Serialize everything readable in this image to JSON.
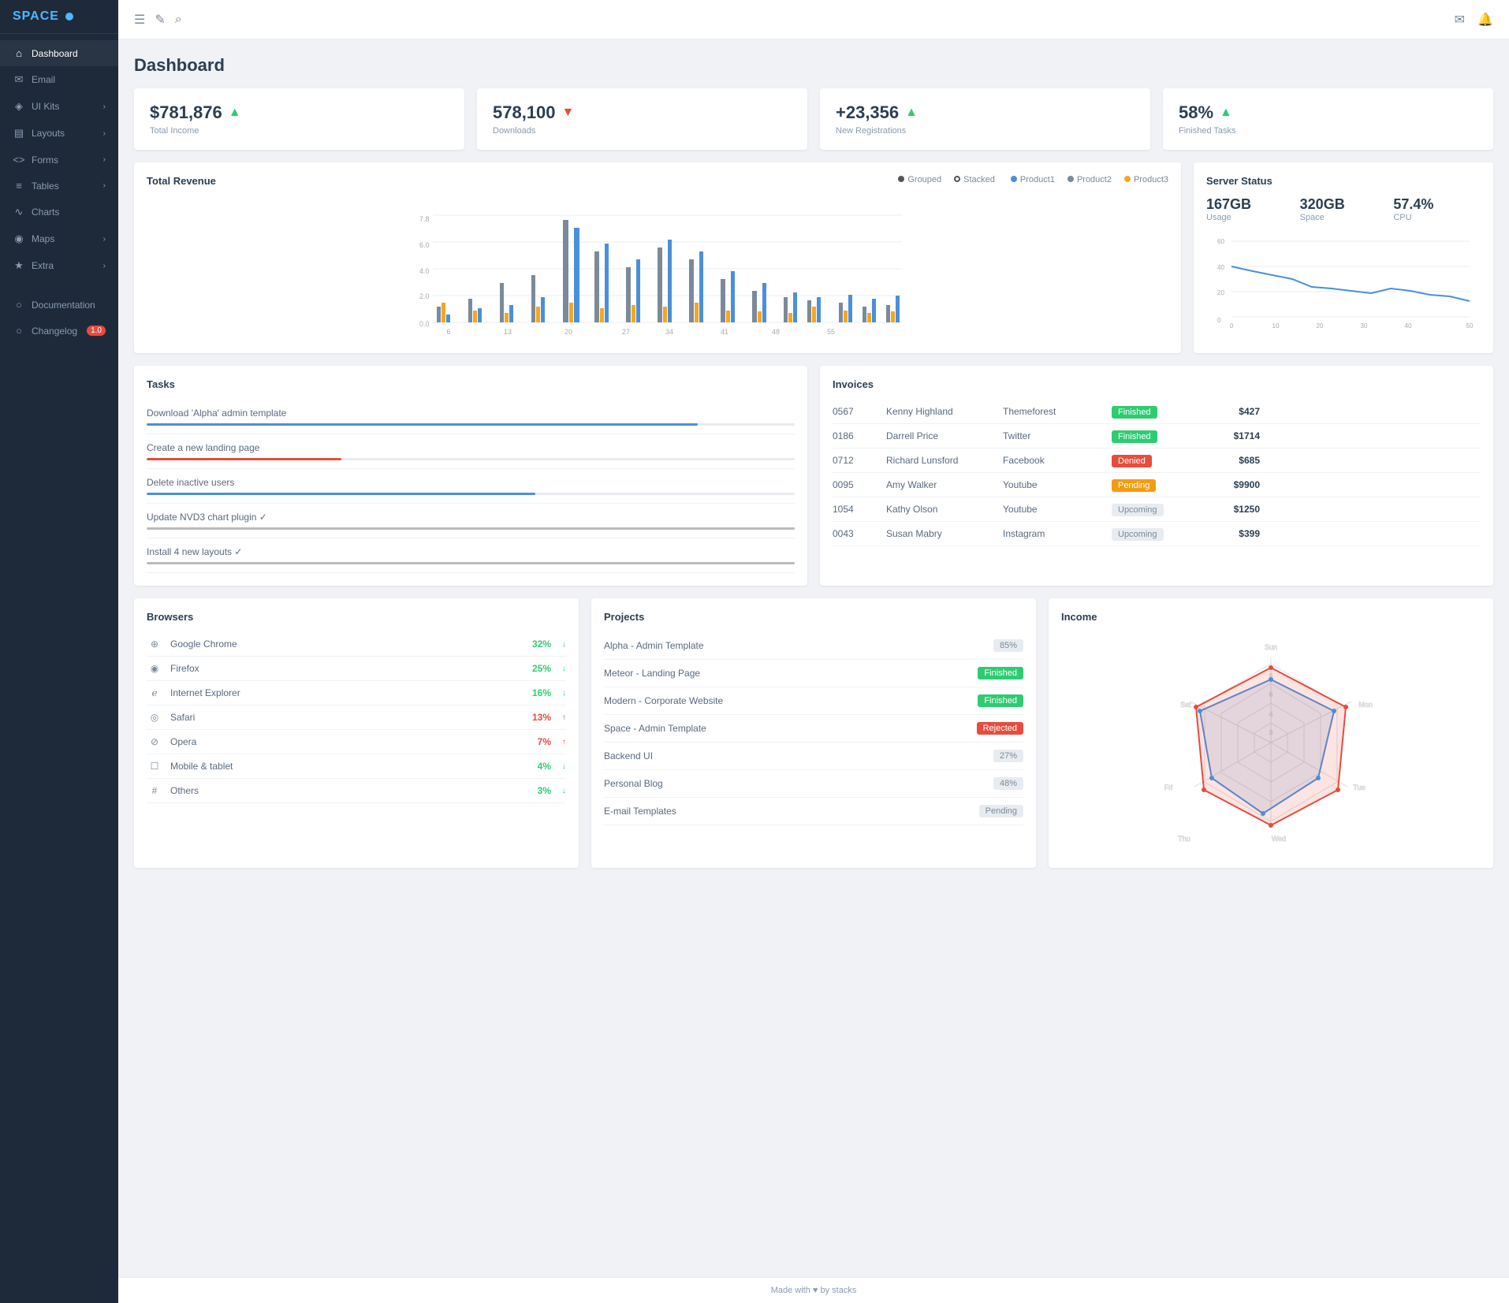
{
  "sidebar": {
    "logo": "SPACE",
    "items": [
      {
        "label": "Dashboard",
        "icon": "⌂",
        "active": true,
        "hasChevron": false
      },
      {
        "label": "Email",
        "icon": "✉",
        "active": false,
        "hasChevron": false
      },
      {
        "label": "UI Kits",
        "icon": "◈",
        "active": false,
        "hasChevron": true
      },
      {
        "label": "Layouts",
        "icon": "▤",
        "active": false,
        "hasChevron": true
      },
      {
        "label": "Forms",
        "icon": "<>",
        "active": false,
        "hasChevron": true
      },
      {
        "label": "Tables",
        "icon": "≡",
        "active": false,
        "hasChevron": true
      },
      {
        "label": "Charts",
        "icon": "∿",
        "active": false,
        "hasChevron": false
      },
      {
        "label": "Maps",
        "icon": "◉",
        "active": false,
        "hasChevron": true
      },
      {
        "label": "Extra",
        "icon": "★",
        "active": false,
        "hasChevron": true
      },
      {
        "label": "Documentation",
        "icon": "○",
        "active": false,
        "hasChevron": false
      },
      {
        "label": "Changelog",
        "icon": "○",
        "active": false,
        "hasChevron": false,
        "badge": "1.0"
      }
    ]
  },
  "header": {
    "title": "Dashboard",
    "topbar_icons": [
      "≡",
      "✎",
      "⌕"
    ]
  },
  "stats": [
    {
      "value": "$781,876",
      "label": "Total Income",
      "trend": "up"
    },
    {
      "value": "578,100",
      "label": "Downloads",
      "trend": "down"
    },
    {
      "value": "+23,356",
      "label": "New Registrations",
      "trend": "up"
    },
    {
      "value": "58%",
      "label": "Finished Tasks",
      "trend": "up"
    }
  ],
  "total_revenue": {
    "title": "Total Revenue",
    "legend": [
      {
        "label": "Grouped",
        "type": "dot",
        "color": "#555"
      },
      {
        "label": "Stacked",
        "type": "circle",
        "color": "#555"
      }
    ],
    "products": [
      {
        "label": "Product1",
        "color": "#4a90d9"
      },
      {
        "label": "Product2",
        "color": "#7a8a9a"
      },
      {
        "label": "Product3",
        "color": "#f5a623"
      }
    ],
    "x_labels": [
      "6",
      "13",
      "20",
      "27",
      "34",
      "41",
      "48",
      "55"
    ]
  },
  "server_status": {
    "title": "Server Status",
    "stats": [
      {
        "value": "167GB",
        "label": "Usage"
      },
      {
        "value": "320GB",
        "label": "Space"
      },
      {
        "value": "57.4%",
        "label": "CPU"
      }
    ],
    "x_labels": [
      "0",
      "10",
      "20",
      "30",
      "40",
      "50"
    ],
    "y_labels": [
      "0",
      "20",
      "40",
      "60"
    ]
  },
  "tasks": {
    "title": "Tasks",
    "items": [
      {
        "name": "Download 'Alpha' admin template",
        "progress": 85,
        "color": "#4a90d9"
      },
      {
        "name": "Create a new landing page",
        "progress": 30,
        "color": "#e74c3c"
      },
      {
        "name": "Delete inactive users",
        "progress": 60,
        "color": "#4a90d9"
      },
      {
        "name": "Update NVD3 chart plugin ✓",
        "progress": 100,
        "color": "#aaa"
      },
      {
        "name": "Install 4 new layouts ✓",
        "progress": 100,
        "color": "#aaa"
      }
    ]
  },
  "invoices": {
    "title": "Invoices",
    "rows": [
      {
        "id": "0567",
        "name": "Kenny Highland",
        "company": "Themeforest",
        "status": "Finished",
        "amount": "$427"
      },
      {
        "id": "0186",
        "name": "Darrell Price",
        "company": "Twitter",
        "status": "Finished",
        "amount": "$1714"
      },
      {
        "id": "0712",
        "name": "Richard Lunsford",
        "company": "Facebook",
        "status": "Denied",
        "amount": "$685"
      },
      {
        "id": "0095",
        "name": "Amy Walker",
        "company": "Youtube",
        "status": "Pending",
        "amount": "$9900"
      },
      {
        "id": "1054",
        "name": "Kathy Olson",
        "company": "Youtube",
        "status": "Upcoming",
        "amount": "$1250"
      },
      {
        "id": "0043",
        "name": "Susan Mabry",
        "company": "Instagram",
        "status": "Upcoming",
        "amount": "$399"
      }
    ]
  },
  "browsers": {
    "title": "Browsers",
    "items": [
      {
        "name": "Google Chrome",
        "icon": "⊕",
        "pct": "32%",
        "trend": "up",
        "color": "green"
      },
      {
        "name": "Firefox",
        "icon": "◉",
        "pct": "25%",
        "trend": "up",
        "color": "green"
      },
      {
        "name": "Internet Explorer",
        "icon": "ℯ",
        "pct": "16%",
        "trend": "up",
        "color": "green"
      },
      {
        "name": "Safari",
        "icon": "◎",
        "pct": "13%",
        "trend": "down",
        "color": "red"
      },
      {
        "name": "Opera",
        "icon": "⊘",
        "pct": "7%",
        "trend": "down",
        "color": "red"
      },
      {
        "name": "Mobile & tablet",
        "icon": "☐",
        "pct": "4%",
        "trend": "up",
        "color": "green"
      },
      {
        "name": "Others",
        "icon": "#",
        "pct": "3%",
        "trend": "up",
        "color": "green"
      }
    ]
  },
  "projects": {
    "title": "Projects",
    "items": [
      {
        "name": "Alpha - Admin Template",
        "status": "85%",
        "badge_type": "gray"
      },
      {
        "name": "Meteor - Landing Page",
        "status": "Finished",
        "badge_type": "green"
      },
      {
        "name": "Modern - Corporate Website",
        "status": "Finished",
        "badge_type": "green"
      },
      {
        "name": "Space - Admin Template",
        "status": "Rejected",
        "badge_type": "red"
      },
      {
        "name": "Backend UI",
        "status": "27%",
        "badge_type": "gray"
      },
      {
        "name": "Personal Blog",
        "status": "48%",
        "badge_type": "gray"
      },
      {
        "name": "E-mail Templates",
        "status": "Pending",
        "badge_type": "gray"
      }
    ]
  },
  "income": {
    "title": "Income",
    "labels": [
      "Sun",
      "Mon",
      "Tue",
      "Wed",
      "Thu",
      "Fri",
      "Sat"
    ]
  },
  "footer": "Made with ♥ by stacks"
}
